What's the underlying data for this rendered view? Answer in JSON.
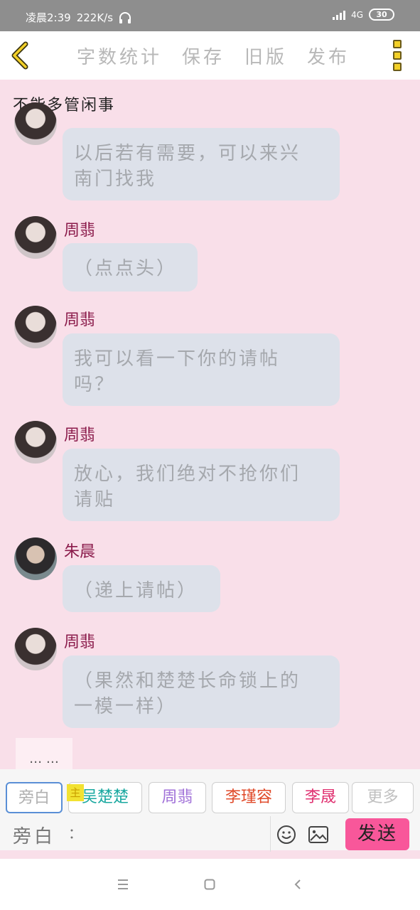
{
  "status_bar": {
    "time": "凌晨2:39",
    "speed": "222K/s",
    "network": "4G",
    "battery": "30"
  },
  "toolbar": {
    "items": [
      "字数统计",
      "保存",
      "旧版",
      "发布"
    ]
  },
  "chat": {
    "title": "不能多管闲事",
    "messages": [
      {
        "sender": "",
        "text_lines": [
          "以后若有需要，可以来兴",
          "南门找我"
        ]
      },
      {
        "sender": "周翡",
        "text_lines": [
          "（点点头）"
        ]
      },
      {
        "sender": "周翡",
        "text_lines": [
          "我可以看一下你的请帖",
          "吗？"
        ]
      },
      {
        "sender": "周翡",
        "text_lines": [
          "放心，我们绝对不抢你们",
          "请贴"
        ]
      },
      {
        "sender": "朱晨",
        "text_lines": [
          "（递上请帖）"
        ]
      },
      {
        "sender": "周翡",
        "text_lines": [
          "（果然和楚楚长命锁上的",
          "一模一样）"
        ]
      }
    ],
    "ellipsis": "… …"
  },
  "roles": {
    "badge": "主",
    "items": [
      {
        "label": "旁白",
        "color": "#b0b0b0"
      },
      {
        "label": "吴楚楚",
        "color": "#1aa8a0"
      },
      {
        "label": "周翡",
        "color": "#a070d8"
      },
      {
        "label": "李瑾容",
        "color": "#e04a2a"
      },
      {
        "label": "李晟",
        "color": "#e03070"
      },
      {
        "label": "更多",
        "color": "#c0c0c0"
      }
    ]
  },
  "input": {
    "label": "旁白",
    "placeholder": "：",
    "send_label": "发送"
  },
  "icons": {
    "back": "chevron-left-icon",
    "more": "vertical-dots-icon",
    "emoji": "smiley-icon",
    "image": "image-icon",
    "nav_menu": "menu-icon",
    "nav_home": "home-square-icon",
    "nav_back": "back-arrow-icon"
  }
}
